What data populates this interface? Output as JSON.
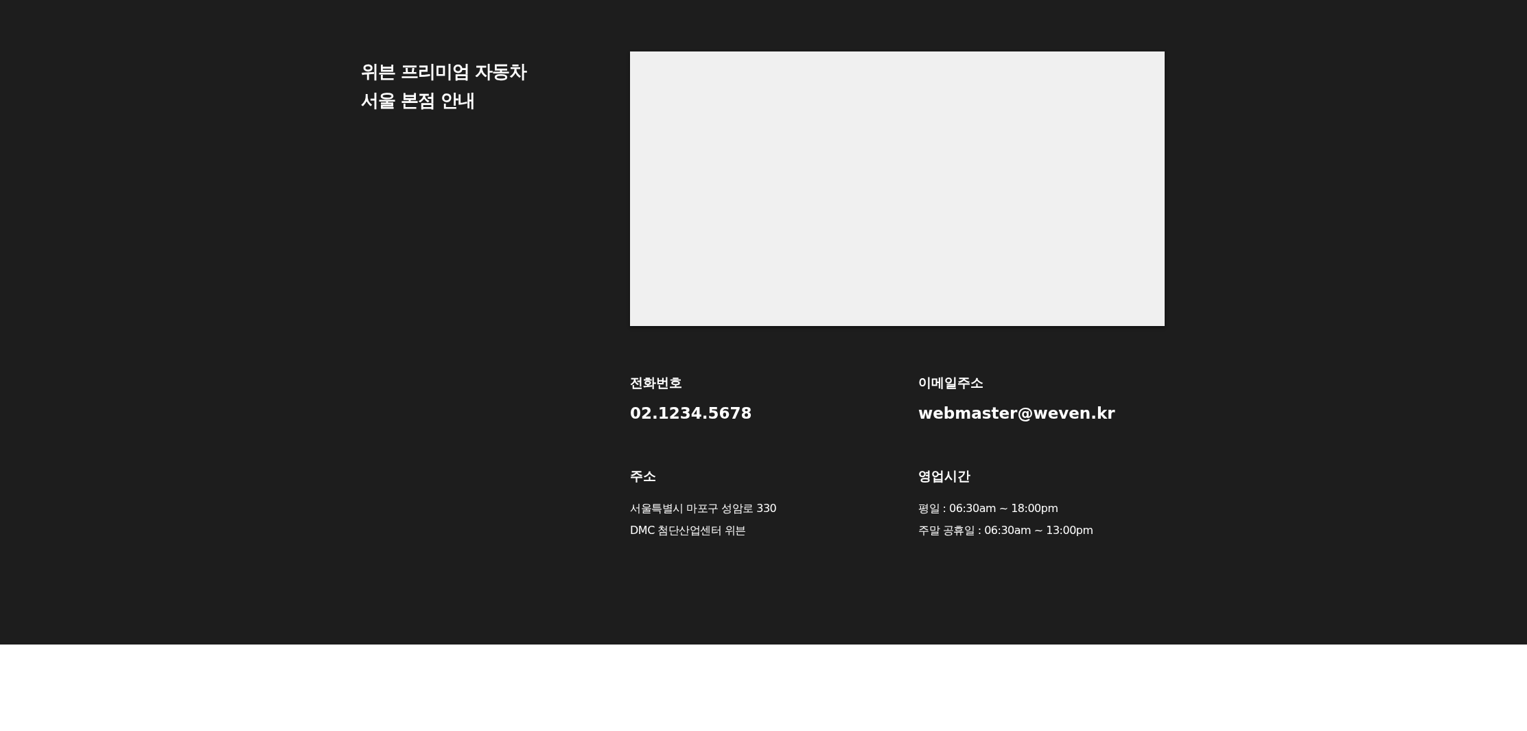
{
  "section": {
    "title_lines": [
      "위븐 프리미엄 자동차",
      "서울 본점 안내"
    ],
    "info": [
      {
        "kind": "contact",
        "label": "전화번호",
        "lines": [
          "02.1234.5678"
        ]
      },
      {
        "kind": "contact",
        "label": "이메일주소",
        "lines": [
          "webmaster@weven.kr"
        ]
      },
      {
        "kind": "detail",
        "label": "주소",
        "lines": [
          "서울특별시 마포구 성암로 330",
          "DMC 첨단산업센터 위븐"
        ]
      },
      {
        "kind": "detail",
        "label": "영업시간",
        "lines": [
          "평일 : 06:30am ~ 18:00pm",
          "주말 공휴일 : 06:30am ~ 13:00pm"
        ]
      }
    ]
  }
}
